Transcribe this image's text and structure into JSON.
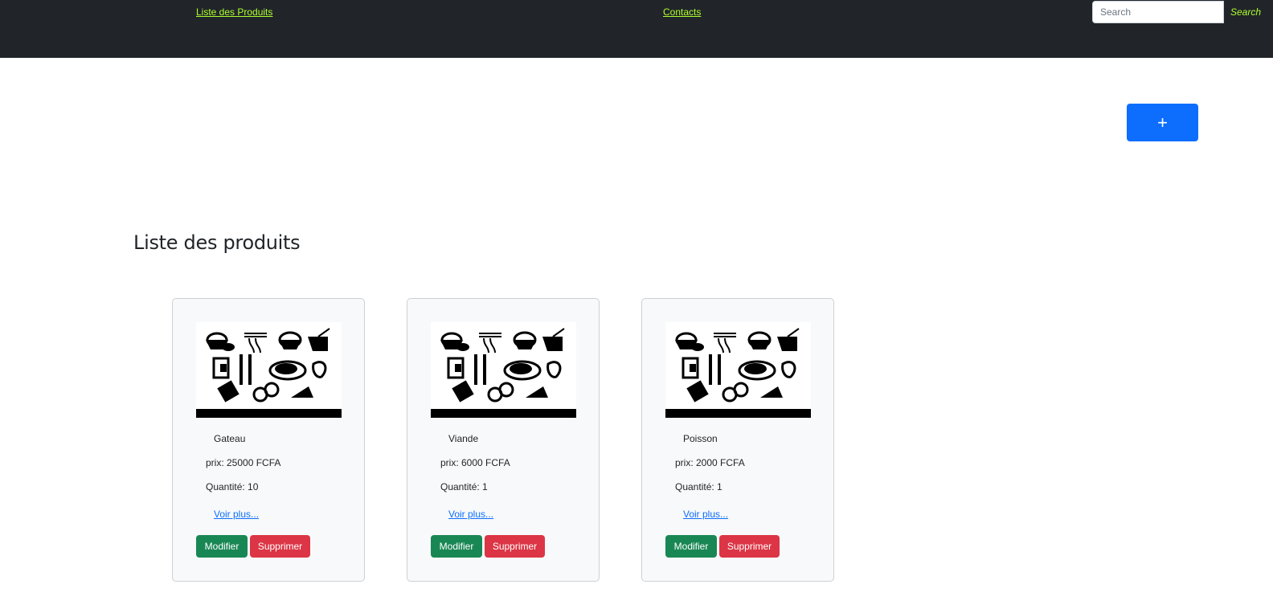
{
  "navbar": {
    "links": [
      "Liste des Produits",
      "Contacts"
    ],
    "search": {
      "placeholder": "Search",
      "value": "",
      "button_label": "Search"
    }
  },
  "add_button_label": "+",
  "page_title": "Liste des produits",
  "colors": {
    "navbar_bg": "#212529",
    "nav_link": "#adff2f",
    "primary": "#0d6efd",
    "success": "#198754",
    "danger": "#dc3545",
    "card_bg": "#f8f9fa"
  },
  "products": [
    {
      "name": "Gateau",
      "price": "prix: 25000 FCFA",
      "quantity": "Quantité: 10",
      "more_label": "Voir plus...",
      "edit_label": "Modifier",
      "delete_label": "Supprimer"
    },
    {
      "name": "Viande",
      "price": "prix: 6000 FCFA",
      "quantity": "Quantité: 1",
      "more_label": "Voir plus...",
      "edit_label": "Modifier",
      "delete_label": "Supprimer"
    },
    {
      "name": "Poisson",
      "price": "prix: 2000 FCFA",
      "quantity": "Quantité: 1",
      "more_label": "Voir plus...",
      "edit_label": "Modifier",
      "delete_label": "Supprimer"
    }
  ]
}
